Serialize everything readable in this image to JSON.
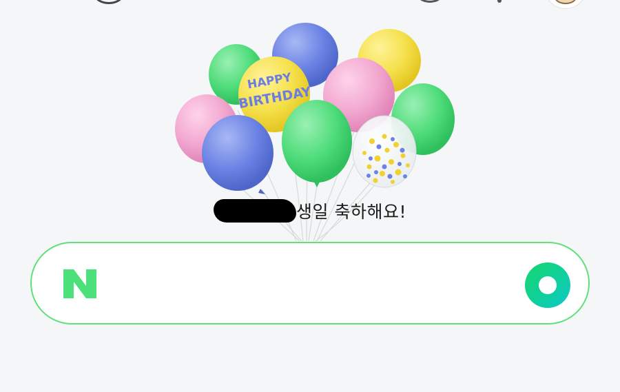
{
  "greeting": {
    "redacted_name": "",
    "message": "생일 축하해요!"
  },
  "balloon_art": {
    "label_line1": "HAPPY",
    "label_line2": "BIRTHDAY"
  },
  "search": {
    "logo_letter": "N",
    "value": "",
    "placeholder": ""
  },
  "colors": {
    "background": "#f4f6f8",
    "naver_green": "#03c75a",
    "search_border": "#5fe07a",
    "balloon_green": "#4fdc7a",
    "balloon_blue": "#6b83e4",
    "balloon_yellow": "#f5e04a",
    "balloon_pink": "#f2a8d0"
  },
  "icons": {
    "logo": "naver-n-logo-icon",
    "green_dot": "green-dot-icon"
  }
}
